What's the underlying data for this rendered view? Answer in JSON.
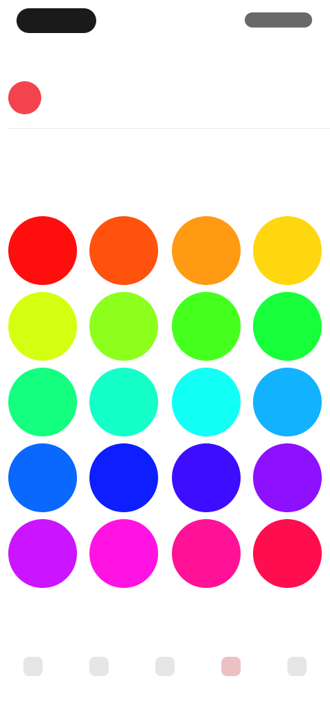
{
  "header": {
    "title": "",
    "action": ""
  },
  "selected": {
    "color": "#f3434e",
    "label": ""
  },
  "section": {
    "label": ""
  },
  "palette": [
    "#ff0e0e",
    "#ff520e",
    "#ff9a12",
    "#ffd710",
    "#d4ff10",
    "#8cff1c",
    "#45ff1d",
    "#16ff3a",
    "#14ff80",
    "#15ffc8",
    "#12fff6",
    "#12b2ff",
    "#0a68ff",
    "#0d1fff",
    "#3d0dff",
    "#8d10ff",
    "#cb14ff",
    "#ff13e2",
    "#ff1296",
    "#ff0e4f"
  ],
  "bottom": {
    "caption_a": "",
    "caption_b": ""
  },
  "tabs": [
    {
      "label": "",
      "icon": "palette-icon",
      "active": false
    },
    {
      "label": "",
      "icon": "grid-icon",
      "active": false
    },
    {
      "label": "",
      "icon": "image-icon",
      "active": false
    },
    {
      "label": "",
      "icon": "color-icon",
      "active": true
    },
    {
      "label": "",
      "icon": "settings-icon",
      "active": false
    }
  ]
}
